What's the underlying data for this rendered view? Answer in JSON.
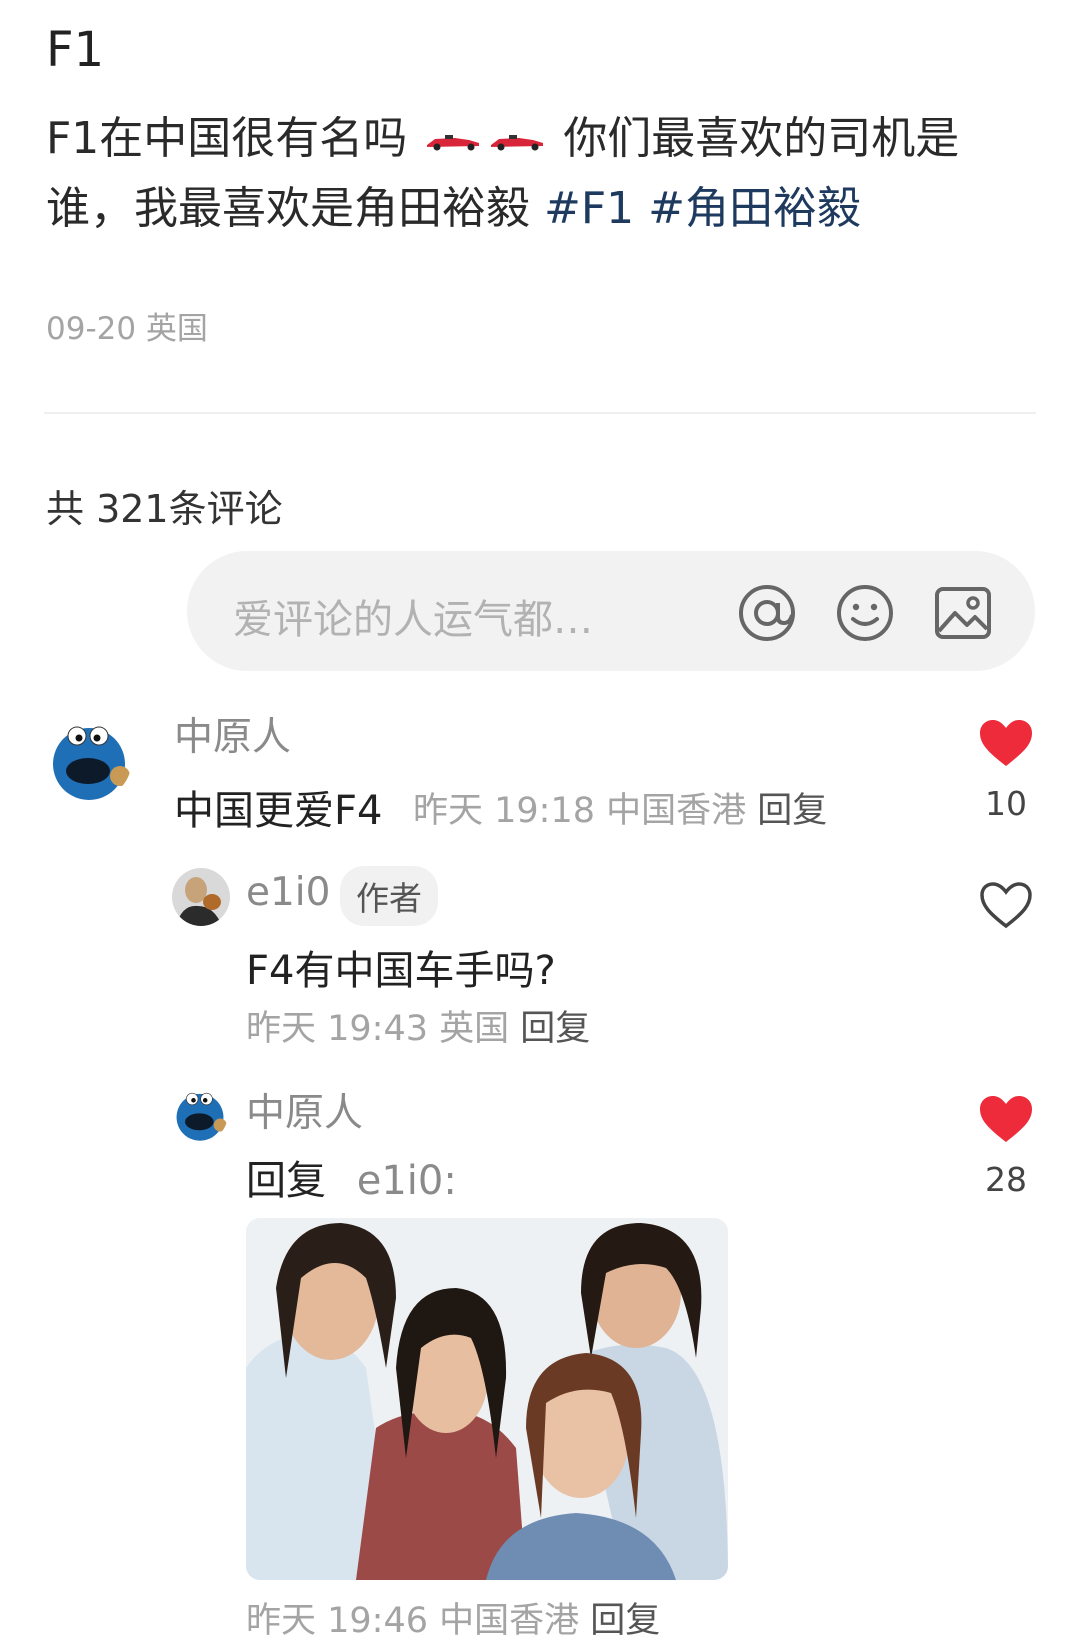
{
  "post": {
    "title": "F1",
    "body_part1": "F1在中国很有名吗",
    "body_part2": "你们最喜欢的司机是谁，我最喜欢是角田裕毅",
    "tags": [
      "#F1",
      "#角田裕毅"
    ],
    "meta": "09-20 英国"
  },
  "comments_header": {
    "count_text": "共 321条评论"
  },
  "comment_input": {
    "placeholder": "爱评论的人运气都…",
    "icons": [
      "at-icon",
      "emoji-icon",
      "image-icon"
    ]
  },
  "comments": [
    {
      "author": "中原人",
      "text": "中国更爱F4",
      "time": "昨天 19:18 中国香港",
      "reply_label": "回复",
      "likes": "10",
      "liked": true,
      "replies": [
        {
          "author": "e1i0",
          "badge": "作者",
          "text": "F4有中国车手吗?",
          "time": "昨天 19:43 英国",
          "reply_label": "回复",
          "liked": false
        },
        {
          "author": "中原人",
          "reply_prefix": "回复",
          "reply_to": "e1i0:",
          "time": "昨天 19:46 中国香港",
          "reply_label": "回复",
          "likes": "28",
          "liked": true
        }
      ]
    }
  ],
  "colors": {
    "heart": "#ee2b3b",
    "tag": "#1f3a5f",
    "meta": "#a4a4a4"
  }
}
